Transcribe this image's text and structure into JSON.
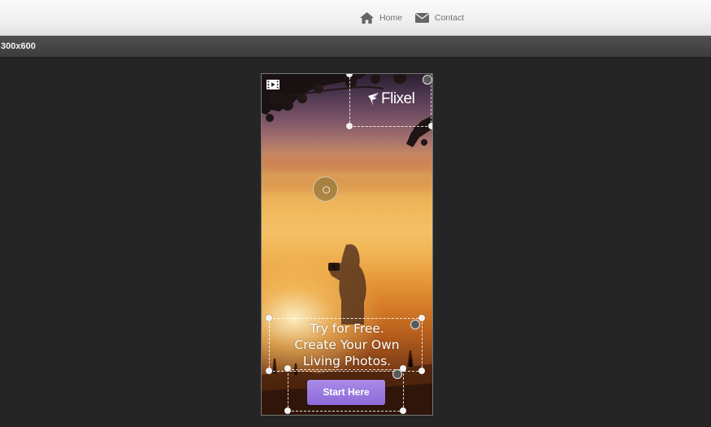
{
  "nav": {
    "home_label": "Home",
    "contact_label": "Contact"
  },
  "sizebar": {
    "label": "300x600"
  },
  "ad": {
    "brand": "Flixel",
    "headline": [
      "Try for Free.",
      "Create Your Own",
      "Living Photos."
    ],
    "cta_label": "Start Here",
    "cta_color": "#9b7ae0"
  },
  "icons": {
    "home": "home-icon",
    "contact": "envelope-icon",
    "media": "film-icon",
    "logo": "flixel-bird-icon"
  }
}
